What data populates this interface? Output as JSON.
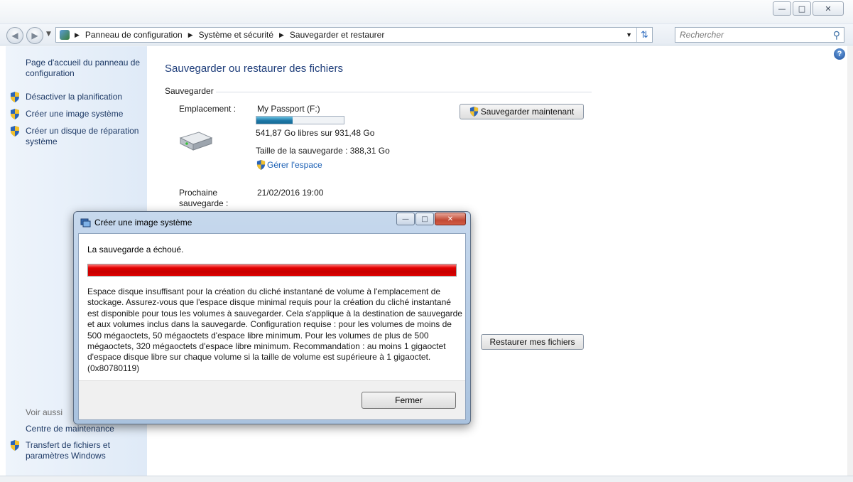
{
  "window": {
    "controls": {
      "minimize_icon": "minimize-icon",
      "maximize_icon": "maximize-icon",
      "close_icon": "close-icon"
    }
  },
  "navbar": {
    "breadcrumb": [
      "Panneau de configuration",
      "Système et sécurité",
      "Sauvegarder et restaurer"
    ],
    "search_placeholder": "Rechercher"
  },
  "sidebar": {
    "home": "Page d'accueil du panneau de configuration",
    "items": [
      {
        "label": "Désactiver la planification",
        "icon": "shield-icon"
      },
      {
        "label": "Créer une image système",
        "icon": "shield-icon"
      },
      {
        "label": "Créer un disque de réparation système",
        "icon": "shield-icon"
      }
    ],
    "see_also_title": "Voir aussi",
    "see_also": [
      {
        "label": "Centre de maintenance",
        "icon": ""
      },
      {
        "label": "Transfert de fichiers et paramètres Windows",
        "icon": "shield-icon"
      }
    ]
  },
  "main": {
    "title": "Sauvegarder ou restaurer des fichiers",
    "backup_section": "Sauvegarder",
    "location_label": "Emplacement :",
    "location_value": "My Passport (F:)",
    "disk_used_fraction": 0.418,
    "free_space": "541,87 Go libres sur 931,48 Go",
    "backup_size": "Taille de la sauvegarde : 388,31 Go",
    "manage_space": "Gérer l'espace",
    "next_backup_label": "Prochaine sauvegarde :",
    "next_backup_value": "21/02/2016 19:00",
    "backup_now": "Sauvegarder maintenant",
    "restore_files": "Restaurer mes fichiers"
  },
  "dialog": {
    "title": "Créer une image système",
    "message": "La sauvegarde a échoué.",
    "progress_fraction": 1.0,
    "progress_color": "#e00000",
    "detail": "Espace disque insuffisant pour la création du cliché instantané de volume à l'emplacement de stockage. Assurez-vous que l'espace disque minimal requis pour la création du cliché instantané est disponible pour tous les volumes à sauvegarder. Cela s'applique à la destination de sauvegarde et aux volumes inclus dans la sauvegarde. Configuration requise : pour les volumes de moins de 500 mégaoctets, 50 mégaoctets d'espace libre minimum. Pour les volumes de plus de 500 mégaoctets, 320 mégaoctets d'espace libre minimum. Recommandation : au moins 1 gigaoctet d'espace disque libre sur chaque volume si la taille de volume est supérieure à 1 gigaoctet. (0x80780119)",
    "close_button": "Fermer"
  }
}
